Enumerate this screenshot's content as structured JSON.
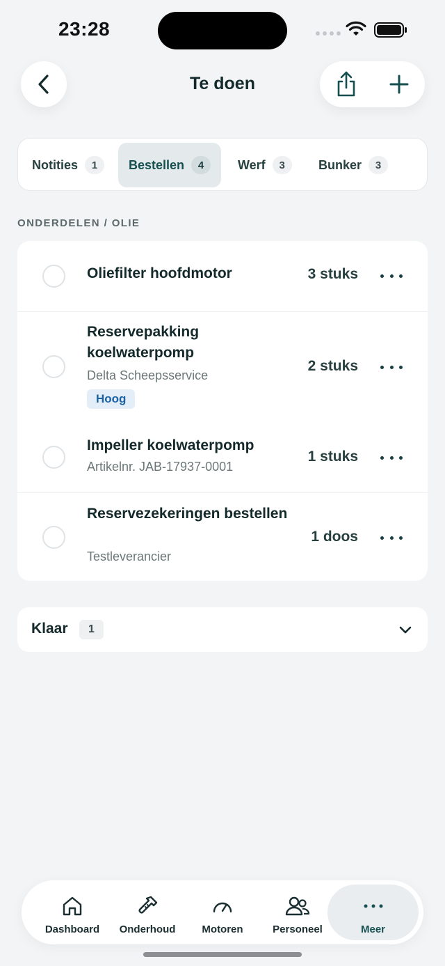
{
  "status_bar": {
    "time": "23:28"
  },
  "header": {
    "title": "Te doen"
  },
  "tabs": [
    {
      "label": "Notities",
      "count": "1",
      "active": false
    },
    {
      "label": "Bestellen",
      "count": "4",
      "active": true
    },
    {
      "label": "Werf",
      "count": "3",
      "active": false
    },
    {
      "label": "Bunker",
      "count": "3",
      "active": false
    }
  ],
  "section": {
    "title": "ONDERDELEN / OLIE"
  },
  "items": [
    {
      "title": "Oliefilter hoofdmotor",
      "subtitle": "",
      "tag": "",
      "quantity": "3 stuks"
    },
    {
      "title": "Reservepakking koelwaterpomp",
      "subtitle": "Delta Scheepsservice",
      "tag": "Hoog",
      "quantity": "2 stuks"
    },
    {
      "title": "Impeller koelwaterpomp",
      "subtitle": "Artikelnr. JAB-17937-0001",
      "tag": "",
      "quantity": "1 stuks"
    },
    {
      "title": "Reservezekeringen bestellen",
      "subtitle": "Testleverancier",
      "tag": "",
      "quantity": "1 doos"
    }
  ],
  "done_section": {
    "label": "Klaar",
    "count": "1"
  },
  "bottom_nav": [
    {
      "label": "Dashboard",
      "icon": "home-icon",
      "active": false
    },
    {
      "label": "Onderhoud",
      "icon": "wrench-icon",
      "active": false
    },
    {
      "label": "Motoren",
      "icon": "gauge-icon",
      "active": false
    },
    {
      "label": "Personeel",
      "icon": "people-icon",
      "active": false
    },
    {
      "label": "Meer",
      "icon": "more-icon",
      "active": true
    }
  ],
  "colors": {
    "accent": "#164f50",
    "background": "#f2f4f6",
    "tag_bg": "#e3eef8",
    "tag_text": "#1d63a4"
  }
}
